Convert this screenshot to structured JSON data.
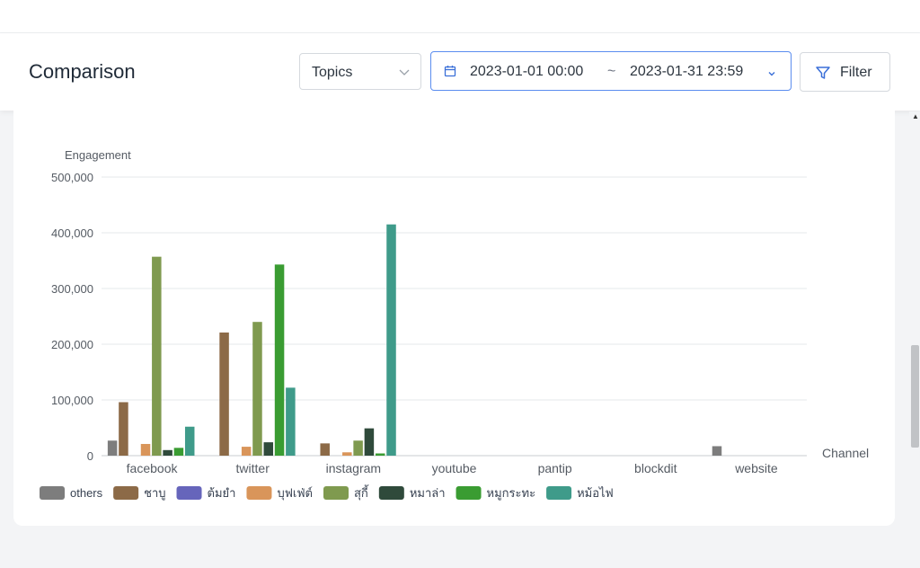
{
  "header": {
    "title": "Comparison",
    "topic_select": "Topics",
    "date_from": "2023-01-01 00:00",
    "date_sep": "~",
    "date_to": "2023-01-31 23:59",
    "filter_label": "Filter"
  },
  "chart_data": {
    "type": "bar",
    "ylabel": "Engagement",
    "xlabel": "Channel",
    "ylim": [
      0,
      500000
    ],
    "yticks": [
      "0",
      "100,000",
      "200,000",
      "300,000",
      "400,000",
      "500,000"
    ],
    "categories": [
      "facebook",
      "twitter",
      "instagram",
      "youtube",
      "pantip",
      "blockdit",
      "website"
    ],
    "grid": true,
    "legend_position": "bottom-left",
    "series": [
      {
        "name": "others",
        "color": "#7d7d7d",
        "values": [
          27000,
          0,
          0,
          0,
          0,
          0,
          17000
        ]
      },
      {
        "name": "ชาบู",
        "color": "#8c6a47",
        "values": [
          96000,
          221000,
          22000,
          0,
          0,
          0,
          0
        ]
      },
      {
        "name": "ต้มยำ",
        "color": "#6665bb",
        "values": [
          0,
          0,
          0,
          0,
          0,
          0,
          0
        ]
      },
      {
        "name": "บุฟเฟ่ต์",
        "color": "#d9955a",
        "values": [
          21000,
          16000,
          6000,
          0,
          0,
          0,
          0
        ]
      },
      {
        "name": "สุกี้",
        "color": "#7f9a4f",
        "values": [
          357000,
          240000,
          27000,
          0,
          0,
          0,
          0
        ]
      },
      {
        "name": "หมาล่า",
        "color": "#2f4a3b",
        "values": [
          10000,
          24000,
          49000,
          0,
          0,
          0,
          0
        ]
      },
      {
        "name": "หมูกระทะ",
        "color": "#3a9c32",
        "values": [
          14000,
          343000,
          4000,
          0,
          0,
          0,
          0
        ]
      },
      {
        "name": "หม้อไฟ",
        "color": "#3f9b8a",
        "values": [
          52000,
          122000,
          415000,
          0,
          0,
          0,
          0
        ]
      }
    ]
  }
}
